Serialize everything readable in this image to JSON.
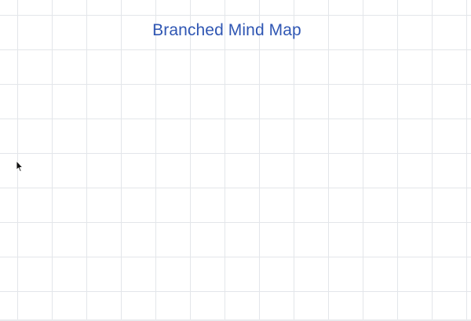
{
  "canvas": {
    "title": "Branched Mind Map",
    "grid_color": "#e3e6ea",
    "title_color": "#2f56b3",
    "background_color": "#ffffff"
  },
  "cursor": {
    "icon": "arrow-pointer-icon"
  }
}
